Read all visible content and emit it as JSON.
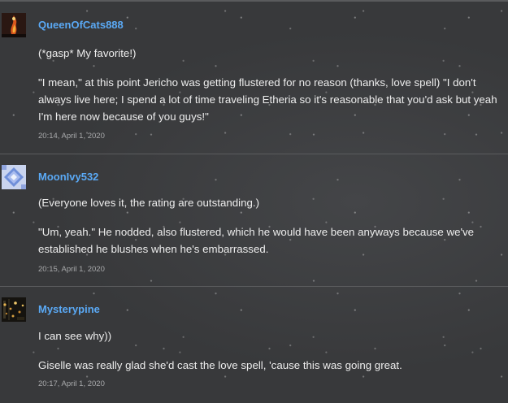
{
  "comments": [
    {
      "username": "QueenOfCats888",
      "avatar_icon": "fire-portrait-avatar",
      "lines": [
        "(*gasp* My favorite!)",
        "\"I mean,\" at this point Jericho was getting flustered for no reason (thanks, love spell) \"I don't always live here; I spend a lot of time traveling Etheria so it's reasonable that you'd ask but yeah I'm here now because of you guys!\""
      ],
      "timestamp": "20:14, April 1, 2020"
    },
    {
      "username": "MoonIvy532",
      "avatar_icon": "blue-diamond-avatar",
      "lines": [
        "(Everyone loves it, the rating are outstanding.)",
        "\"Um, yeah.\" He nodded, also flustered, which he would have been anyways because we've established he blushes when he's embarrassed."
      ],
      "timestamp": "20:15, April 1, 2020"
    },
    {
      "username": "Mysterypine",
      "avatar_icon": "night-lights-avatar",
      "lines": [
        "I can see why))",
        "Giselle was really glad she'd cast the love spell, 'cause this was going great."
      ],
      "timestamp": "20:17, April 1, 2020"
    }
  ],
  "colors": {
    "background": "#38393b",
    "username": "#5aa9f5",
    "text": "#ededed",
    "timestamp": "#a8a9ab",
    "divider": "#5b5c5e"
  }
}
